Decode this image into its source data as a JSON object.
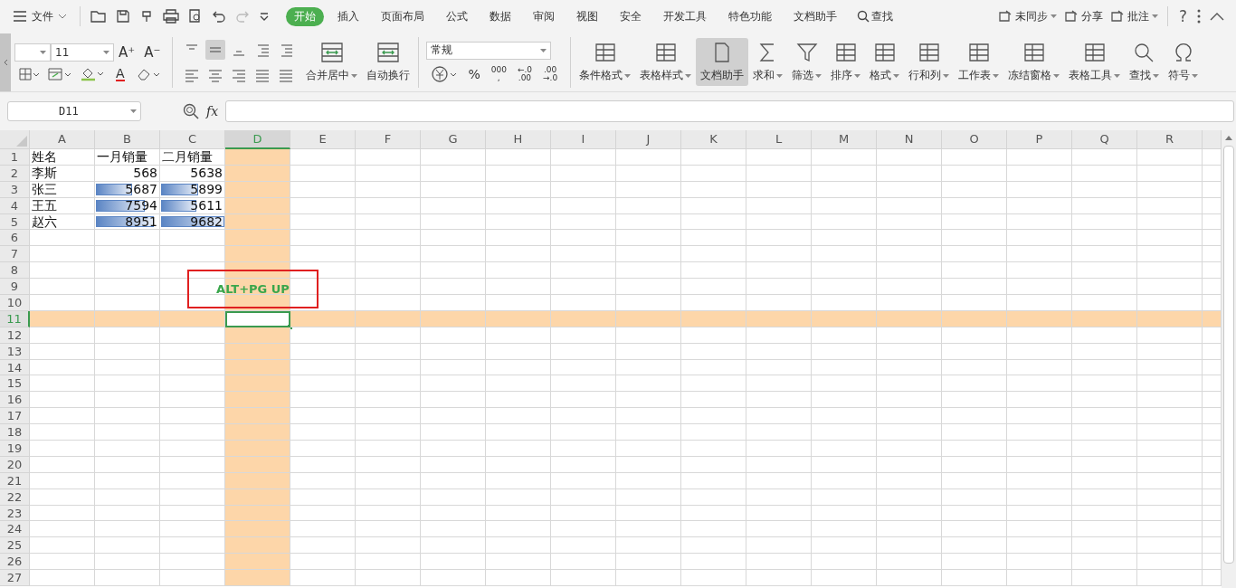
{
  "menu_bar": {
    "file_label": "文件",
    "tabs": [
      {
        "label": "开始",
        "selected": true
      },
      {
        "label": "插入",
        "selected": false
      },
      {
        "label": "页面布局",
        "selected": false
      },
      {
        "label": "公式",
        "selected": false
      },
      {
        "label": "数据",
        "selected": false
      },
      {
        "label": "审阅",
        "selected": false
      },
      {
        "label": "视图",
        "selected": false
      },
      {
        "label": "安全",
        "selected": false
      },
      {
        "label": "开发工具",
        "selected": false
      },
      {
        "label": "特色功能",
        "selected": false
      },
      {
        "label": "文档助手",
        "selected": false
      }
    ],
    "search_label": "查找",
    "actions": [
      {
        "label": "未同步",
        "dropdown": true
      },
      {
        "label": "分享",
        "dropdown": false
      },
      {
        "label": "批注",
        "dropdown": true
      }
    ],
    "help_glyph": "?"
  },
  "ribbon": {
    "font_size": "11",
    "font_tools": [
      "A⁺",
      "A⁻"
    ],
    "font_color_glyph": "A",
    "large_buttons_a": [
      {
        "label": "合并居中",
        "dropdown": true,
        "selected": false
      },
      {
        "label": "自动换行",
        "dropdown": false,
        "selected": false
      }
    ],
    "number_format": "常规",
    "number_tools": [
      {
        "lines": [
          "%"
        ]
      },
      {
        "lines": [
          "000",
          ","
        ]
      },
      {
        "lines": [
          "←.0",
          ".00"
        ]
      },
      {
        "lines": [
          ".00",
          "→.0"
        ]
      }
    ],
    "large_buttons_b": [
      {
        "label": "条件格式",
        "dropdown": true,
        "selected": false
      },
      {
        "label": "表格样式",
        "dropdown": true,
        "selected": false
      },
      {
        "label": "文档助手",
        "dropdown": false,
        "selected": true
      },
      {
        "label": "求和",
        "dropdown": true,
        "selected": false
      },
      {
        "label": "筛选",
        "dropdown": true,
        "selected": false
      },
      {
        "label": "排序",
        "dropdown": true,
        "selected": false
      },
      {
        "label": "格式",
        "dropdown": true,
        "selected": false
      },
      {
        "label": "行和列",
        "dropdown": true,
        "selected": false
      },
      {
        "label": "工作表",
        "dropdown": true,
        "selected": false
      },
      {
        "label": "冻结窗格",
        "dropdown": true,
        "selected": false
      },
      {
        "label": "表格工具",
        "dropdown": true,
        "selected": false
      },
      {
        "label": "查找",
        "dropdown": true,
        "selected": false
      },
      {
        "label": "符号",
        "dropdown": true,
        "selected": false
      }
    ]
  },
  "formula_bar": {
    "name_box": "D11",
    "fx_glyph": "fx"
  },
  "sheet": {
    "columns": [
      {
        "label": "A",
        "selected": false
      },
      {
        "label": "B",
        "selected": false
      },
      {
        "label": "C",
        "selected": false
      },
      {
        "label": "D",
        "selected": true
      },
      {
        "label": "E",
        "selected": false
      },
      {
        "label": "F",
        "selected": false
      },
      {
        "label": "G",
        "selected": false
      },
      {
        "label": "H",
        "selected": false
      },
      {
        "label": "I",
        "selected": false
      },
      {
        "label": "J",
        "selected": false
      },
      {
        "label": "K",
        "selected": false
      },
      {
        "label": "L",
        "selected": false
      },
      {
        "label": "M",
        "selected": false
      },
      {
        "label": "N",
        "selected": false
      },
      {
        "label": "O",
        "selected": false
      },
      {
        "label": "P",
        "selected": false
      },
      {
        "label": "Q",
        "selected": false
      },
      {
        "label": "R",
        "selected": false
      }
    ],
    "rows": [
      {
        "label": "1",
        "selected": false,
        "cells": [
          {
            "kind": "text",
            "text": "姓名"
          },
          {
            "kind": "text",
            "text": "一月销量"
          },
          {
            "kind": "text",
            "text": "二月销量"
          }
        ]
      },
      {
        "label": "2",
        "selected": false,
        "cells": [
          {
            "kind": "text",
            "text": "李斯"
          },
          {
            "kind": "number",
            "text": "568"
          },
          {
            "kind": "number",
            "text": "5638"
          }
        ]
      },
      {
        "label": "3",
        "selected": false,
        "cells": [
          {
            "kind": "text",
            "text": "张三"
          },
          {
            "kind": "number",
            "text": "5687",
            "level": 0.56
          },
          {
            "kind": "number",
            "text": "5899",
            "level": 0.58
          }
        ]
      },
      {
        "label": "4",
        "selected": false,
        "cells": [
          {
            "kind": "text",
            "text": "王五"
          },
          {
            "kind": "number",
            "text": "7594",
            "level": 0.76
          },
          {
            "kind": "number",
            "text": "5611",
            "level": 0.55
          }
        ]
      },
      {
        "label": "5",
        "selected": false,
        "cells": [
          {
            "kind": "text",
            "text": "赵六"
          },
          {
            "kind": "number",
            "text": "8951",
            "level": 0.9
          },
          {
            "kind": "number",
            "text": "9682",
            "level": 0.98
          }
        ]
      },
      {
        "label": "6",
        "selected": false,
        "cells": []
      },
      {
        "label": "7",
        "selected": false,
        "cells": []
      },
      {
        "label": "8",
        "selected": false,
        "cells": []
      },
      {
        "label": "9",
        "selected": false,
        "cells": []
      },
      {
        "label": "10",
        "selected": false,
        "cells": []
      },
      {
        "label": "11",
        "selected": true,
        "cells": []
      },
      {
        "label": "12",
        "selected": false,
        "cells": []
      },
      {
        "label": "13",
        "selected": false,
        "cells": []
      },
      {
        "label": "14",
        "selected": false,
        "cells": []
      },
      {
        "label": "15",
        "selected": false,
        "cells": []
      },
      {
        "label": "16",
        "selected": false,
        "cells": []
      },
      {
        "label": "17",
        "selected": false,
        "cells": []
      },
      {
        "label": "18",
        "selected": false,
        "cells": []
      },
      {
        "label": "19",
        "selected": false,
        "cells": []
      },
      {
        "label": "20",
        "selected": false,
        "cells": []
      },
      {
        "label": "21",
        "selected": false,
        "cells": []
      },
      {
        "label": "22",
        "selected": false,
        "cells": []
      },
      {
        "label": "23",
        "selected": false,
        "cells": []
      },
      {
        "label": "24",
        "selected": false,
        "cells": []
      },
      {
        "label": "25",
        "selected": false,
        "cells": []
      },
      {
        "label": "26",
        "selected": false,
        "cells": []
      },
      {
        "label": "27",
        "selected": false,
        "cells": []
      }
    ],
    "annotation": "ALT+PG UP"
  }
}
